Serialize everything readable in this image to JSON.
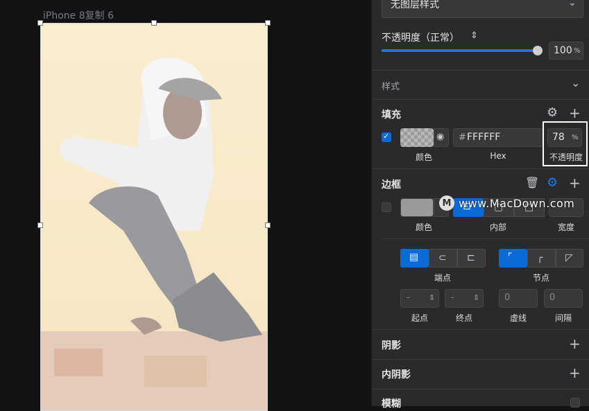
{
  "canvas": {
    "artboard_label": "iPhone 8复制 6"
  },
  "layer_style": {
    "dropdown_value": "无图层样式"
  },
  "opacity": {
    "label": "不透明度（正常）",
    "value": "100",
    "unit": "%",
    "slider_fraction": 1.0
  },
  "style_section": {
    "label": "样式"
  },
  "fill": {
    "title": "填充",
    "checked": true,
    "hex_prefix": "#",
    "hex": "FFFFFF",
    "opacity": "78",
    "opacity_unit": "%",
    "color_label": "颜色",
    "hex_label": "Hex",
    "opacity_label": "不透明度"
  },
  "border": {
    "title": "边框",
    "checked": false,
    "color_label": "颜色",
    "position_label": "内部",
    "width_label": "宽度"
  },
  "endpoints": {
    "cap_label": "端点",
    "join_label": "节点"
  },
  "dash": {
    "start_label": "起点",
    "end_label": "终点",
    "dash_label": "虚线",
    "gap_label": "间隔",
    "start_value": "-",
    "end_value": "-",
    "dash_value": "0",
    "gap_value": "0"
  },
  "sections": {
    "shadow": "阴影",
    "inner_shadow": "内阴影",
    "blur": "模糊"
  },
  "watermark": "www.MacDown.com",
  "colors": {
    "accent": "#0a6bd6",
    "panel": "#2a2a2d",
    "canvas": "#111214"
  }
}
